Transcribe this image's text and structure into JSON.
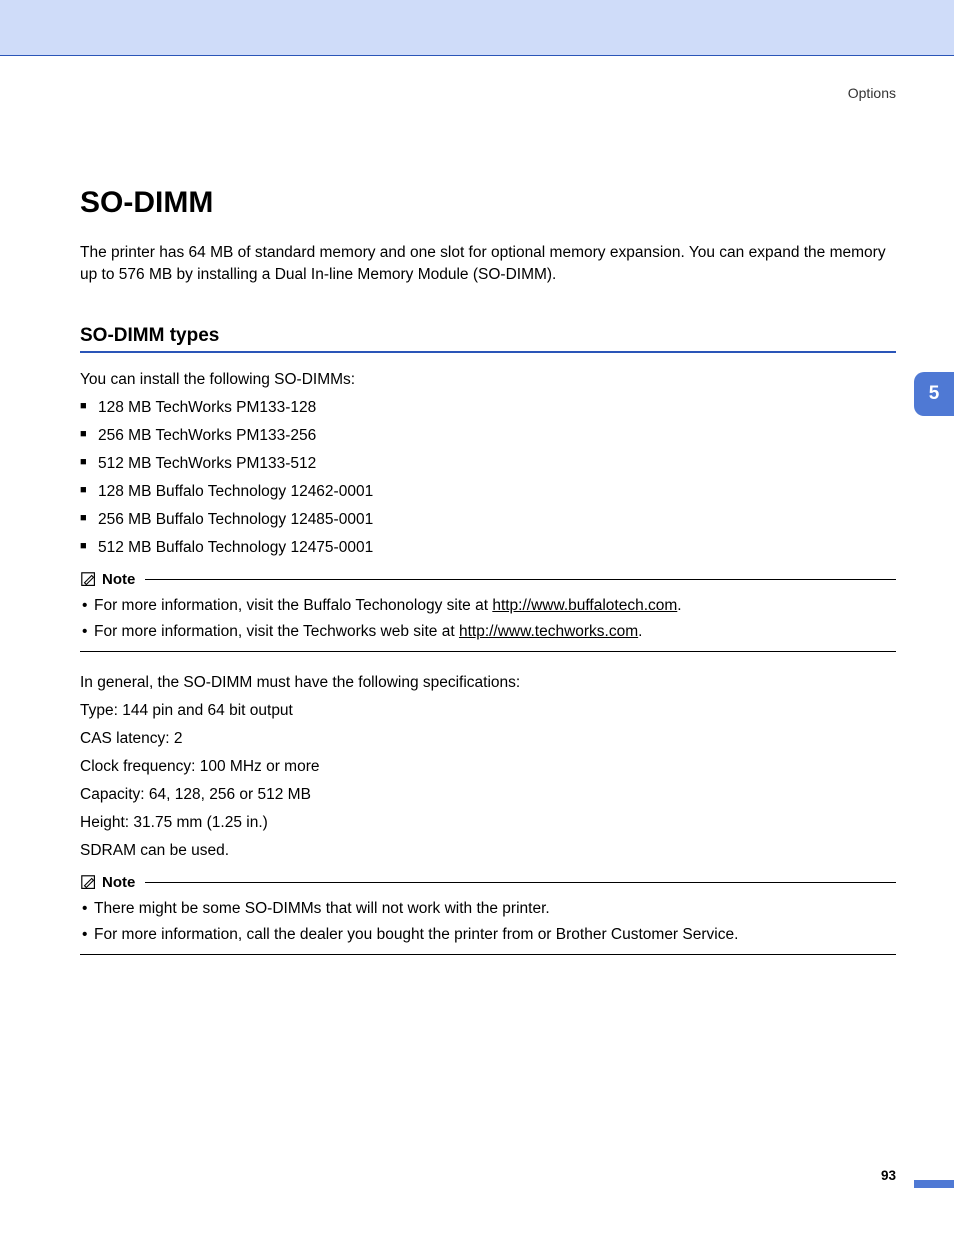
{
  "header": {
    "section": "Options"
  },
  "title": "SO-DIMM",
  "intro": "The printer has 64 MB of standard memory and one slot for optional memory expansion. You can expand the memory up to 576 MB by installing a Dual In-line Memory Module (SO-DIMM).",
  "subtitle": "SO-DIMM types",
  "lead": "You can install the following SO-DIMMs:",
  "items": [
    "128 MB TechWorks PM133-128",
    "256 MB TechWorks PM133-256",
    "512 MB TechWorks PM133-512",
    "128 MB Buffalo Technology 12462-0001",
    "256 MB Buffalo Technology 12485-0001",
    "512 MB Buffalo Technology 12475-0001"
  ],
  "note1": {
    "label": "Note",
    "n0a": "For more information, visit the Buffalo Techonology site at ",
    "n0link": "http://www.buffalotech.com",
    "n0b": ".",
    "n1a": "For more information, visit the Techworks web site at ",
    "n1link": "http://www.techworks.com",
    "n1b": "."
  },
  "spec_lead": "In general, the SO-DIMM must have the following specifications:",
  "specs": [
    "Type: 144 pin and 64 bit output",
    "CAS latency: 2",
    "Clock frequency: 100 MHz or more",
    "Capacity: 64, 128, 256 or 512 MB",
    "Height: 31.75 mm (1.25 in.)",
    "SDRAM can be used."
  ],
  "note2": {
    "label": "Note",
    "items": [
      "There might be some SO-DIMMs that will not work with the printer.",
      "For more information, call the dealer you bought the printer from or Brother Customer Service."
    ]
  },
  "side_tab": "5",
  "page_num": "93"
}
